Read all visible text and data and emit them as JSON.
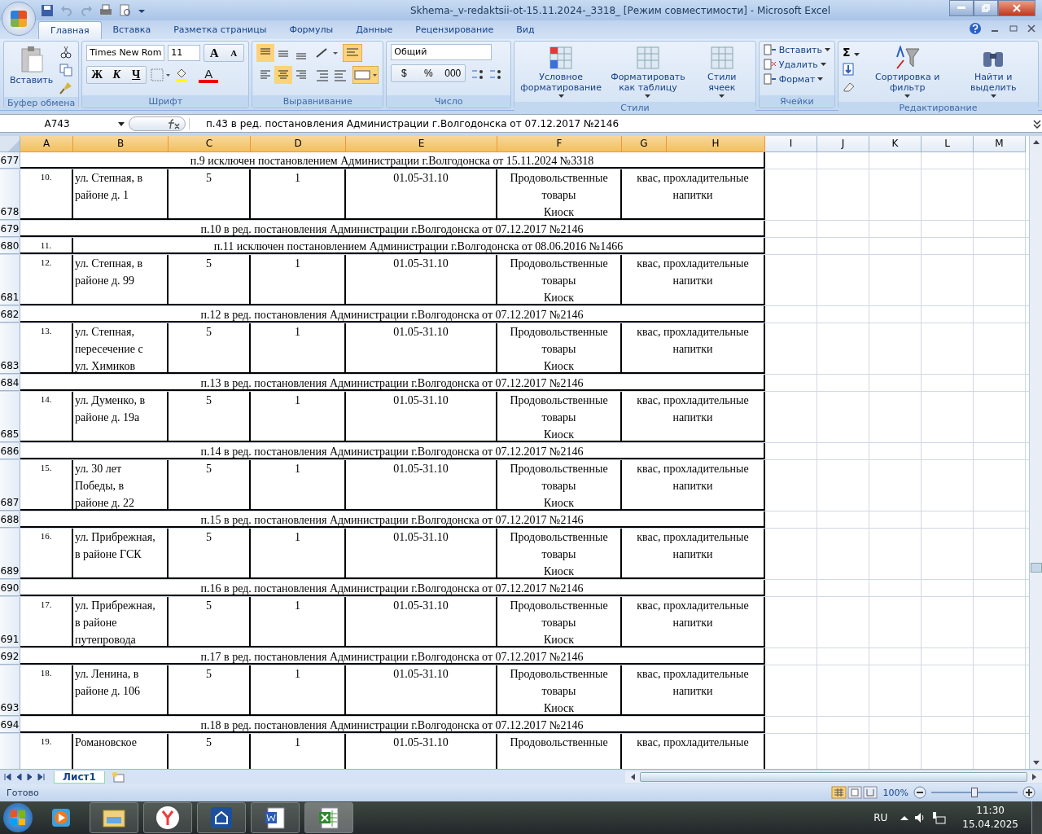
{
  "window": {
    "title": "Skhema-_v-redaktsii-ot-15.11.2024-_3318_  [Режим совместимости] - Microsoft Excel"
  },
  "tabs": [
    {
      "label": "Главная",
      "selected": true
    },
    {
      "label": "Вставка",
      "selected": false
    },
    {
      "label": "Разметка страницы",
      "selected": false
    },
    {
      "label": "Формулы",
      "selected": false
    },
    {
      "label": "Данные",
      "selected": false
    },
    {
      "label": "Рецензирование",
      "selected": false
    },
    {
      "label": "Вид",
      "selected": false
    }
  ],
  "ribbon": {
    "clipboard": {
      "label": "Буфер обмена",
      "paste": "Вставить"
    },
    "font": {
      "label": "Шрифт",
      "font_name": "Times New Rom",
      "font_size": "11",
      "grow": "A",
      "shrink": "A",
      "bold": "Ж",
      "italic": "К",
      "underline": "Ч",
      "font_color": "A"
    },
    "alignment": {
      "label": "Выравнивание"
    },
    "number": {
      "label": "Число",
      "format": "Общий",
      "currency": "$",
      "percent": "%",
      "thousands": "000"
    },
    "styles": {
      "label": "Стили",
      "buttons": [
        "Условное форматирование",
        "Форматировать как таблицу",
        "Стили ячеек"
      ]
    },
    "cells": {
      "label": "Ячейки",
      "buttons": [
        "Вставить",
        "Удалить",
        "Формат"
      ]
    },
    "editing": {
      "label": "Редактирование",
      "sum": "Σ",
      "buttons": [
        "Сортировка и фильтр",
        "Найти и выделить"
      ]
    }
  },
  "sheet": {
    "name_box": "A743",
    "formula": "п.43 в ред. постановления Администрации г.Волгодонска от 07.12.2017 №2146",
    "columns": [
      {
        "label": "A",
        "selected": true
      },
      {
        "label": "B",
        "selected": true
      },
      {
        "label": "C",
        "selected": true
      },
      {
        "label": "D",
        "selected": true
      },
      {
        "label": "E",
        "selected": true
      },
      {
        "label": "F",
        "selected": true
      },
      {
        "label": "G",
        "selected": true
      },
      {
        "label": "H",
        "selected": true
      },
      {
        "label": "I",
        "selected": false
      },
      {
        "label": "J",
        "selected": false
      },
      {
        "label": "K",
        "selected": false
      },
      {
        "label": "L",
        "selected": false
      },
      {
        "label": "M",
        "selected": false
      }
    ],
    "rows": [
      {
        "number": "677",
        "kind": "note",
        "text": "п.9 исключен  постановлением Администрации г.Волгодонска от 15.11.2024 №3318"
      },
      {
        "number": "678",
        "kind": "entry",
        "a": "10.",
        "b": [
          "ул. Степная, в",
          "районе д. 1"
        ],
        "c": "5",
        "d": "1",
        "e": "01.05-31.10",
        "f": [
          "Продовольственные",
          "товары",
          "Киоск"
        ],
        "gh": [
          "квас, прохладительные",
          "напитки"
        ]
      },
      {
        "number": "679",
        "kind": "note",
        "text": "п.10 в ред. постановления Администрации г.Волгодонска от 07.12.2017 №2146"
      },
      {
        "number": "680",
        "kind": "excluded",
        "a": "11.",
        "text": "п.11 исключен  постановлением Администрации г.Волгодонска от 08.06.2016 №1466"
      },
      {
        "number": "681",
        "kind": "entry",
        "a": "12.",
        "b": [
          "ул. Степная, в",
          "районе д. 99"
        ],
        "c": "5",
        "d": "1",
        "e": "01.05-31.10",
        "f": [
          "Продовольственные",
          "товары",
          "Киоск"
        ],
        "gh": [
          "квас, прохладительные",
          "напитки"
        ]
      },
      {
        "number": "682",
        "kind": "note",
        "text": "п.12 в ред. постановления Администрации г.Волгодонска от 07.12.2017 №2146"
      },
      {
        "number": "683",
        "kind": "entry",
        "a": "13.",
        "b": [
          "ул. Степная,",
          "пересечение с",
          "ул. Химиков"
        ],
        "c": "5",
        "d": "1",
        "e": "01.05-31.10",
        "f": [
          "Продовольственные",
          "товары",
          "Киоск"
        ],
        "gh": [
          "квас, прохладительные",
          "напитки"
        ]
      },
      {
        "number": "684",
        "kind": "note",
        "text": "п.13 в ред. постановления Администрации г.Волгодонска от 07.12.2017 №2146"
      },
      {
        "number": "685",
        "kind": "entry",
        "a": "14.",
        "b": [
          "ул. Думенко,  в",
          "районе д. 19а"
        ],
        "c": "5",
        "d": "1",
        "e": "01.05-31.10",
        "f": [
          "Продовольственные",
          "товары",
          "Киоск"
        ],
        "gh": [
          "квас, прохладительные",
          "напитки"
        ]
      },
      {
        "number": "686",
        "kind": "note",
        "text": "п.14 в ред. постановления Администрации г.Волгодонска от 07.12.2017 №2146"
      },
      {
        "number": "687",
        "kind": "entry",
        "a": "15.",
        "b": [
          "ул. 30 лет",
          "Победы, в",
          "районе д. 22"
        ],
        "c": "5",
        "d": "1",
        "e": "01.05-31.10",
        "f": [
          "Продовольственные",
          "товары",
          "Киоск"
        ],
        "gh": [
          "квас, прохладительные",
          "напитки"
        ]
      },
      {
        "number": "688",
        "kind": "note",
        "text": "п.15 в ред. постановления Администрации г.Волгодонска от 07.12.2017 №2146"
      },
      {
        "number": "689",
        "kind": "entry",
        "a": "16.",
        "b": [
          "ул. Прибрежная,",
          "в районе ГСК"
        ],
        "c": "5",
        "d": "1",
        "e": "01.05-31.10",
        "f": [
          "Продовольственные",
          "товары",
          "Киоск"
        ],
        "gh": [
          "квас, прохладительные",
          "напитки"
        ]
      },
      {
        "number": "690",
        "kind": "note",
        "text": "п.16 в ред. постановления Администрации г.Волгодонска от 07.12.2017 №2146"
      },
      {
        "number": "691",
        "kind": "entry",
        "a": "17.",
        "b": [
          "ул. Прибрежная,",
          "в районе",
          "путепровода"
        ],
        "c": "5",
        "d": "1",
        "e": "01.05-31.10",
        "f": [
          "Продовольственные",
          "товары",
          "Киоск"
        ],
        "gh": [
          "квас, прохладительные",
          "напитки"
        ]
      },
      {
        "number": "692",
        "kind": "note",
        "text": "п.17 в ред. постановления Администрации г.Волгодонска от 07.12.2017 №2146"
      },
      {
        "number": "693",
        "kind": "entry",
        "a": "18.",
        "b": [
          "ул. Ленина, в",
          "районе д. 106"
        ],
        "c": "5",
        "d": "1",
        "e": "01.05-31.10",
        "f": [
          "Продовольственные",
          "товары",
          "Киоск"
        ],
        "gh": [
          "квас, прохладительные",
          "напитки"
        ]
      },
      {
        "number": "694",
        "kind": "note",
        "text": "п.18 в ред. постановления Администрации г.Волгодонска от 07.12.2017 №2146"
      },
      {
        "kind": "entry",
        "a": "19.",
        "b": [
          "Романовское"
        ],
        "c": "5",
        "d": "1",
        "e": "01.05-31.10",
        "f": [
          "Продовольственные"
        ],
        "gh": [
          "квас, прохладительные"
        ]
      }
    ]
  },
  "sheet_tabs": [
    {
      "label": "Лист1",
      "selected": true
    }
  ],
  "status_bar": {
    "status": "Готово",
    "zoom": "100%",
    "zoom_slider": {
      "level": 0.5
    }
  },
  "taskbar": {
    "language": "RU",
    "time": "11:30",
    "date": "15.04.2025"
  }
}
